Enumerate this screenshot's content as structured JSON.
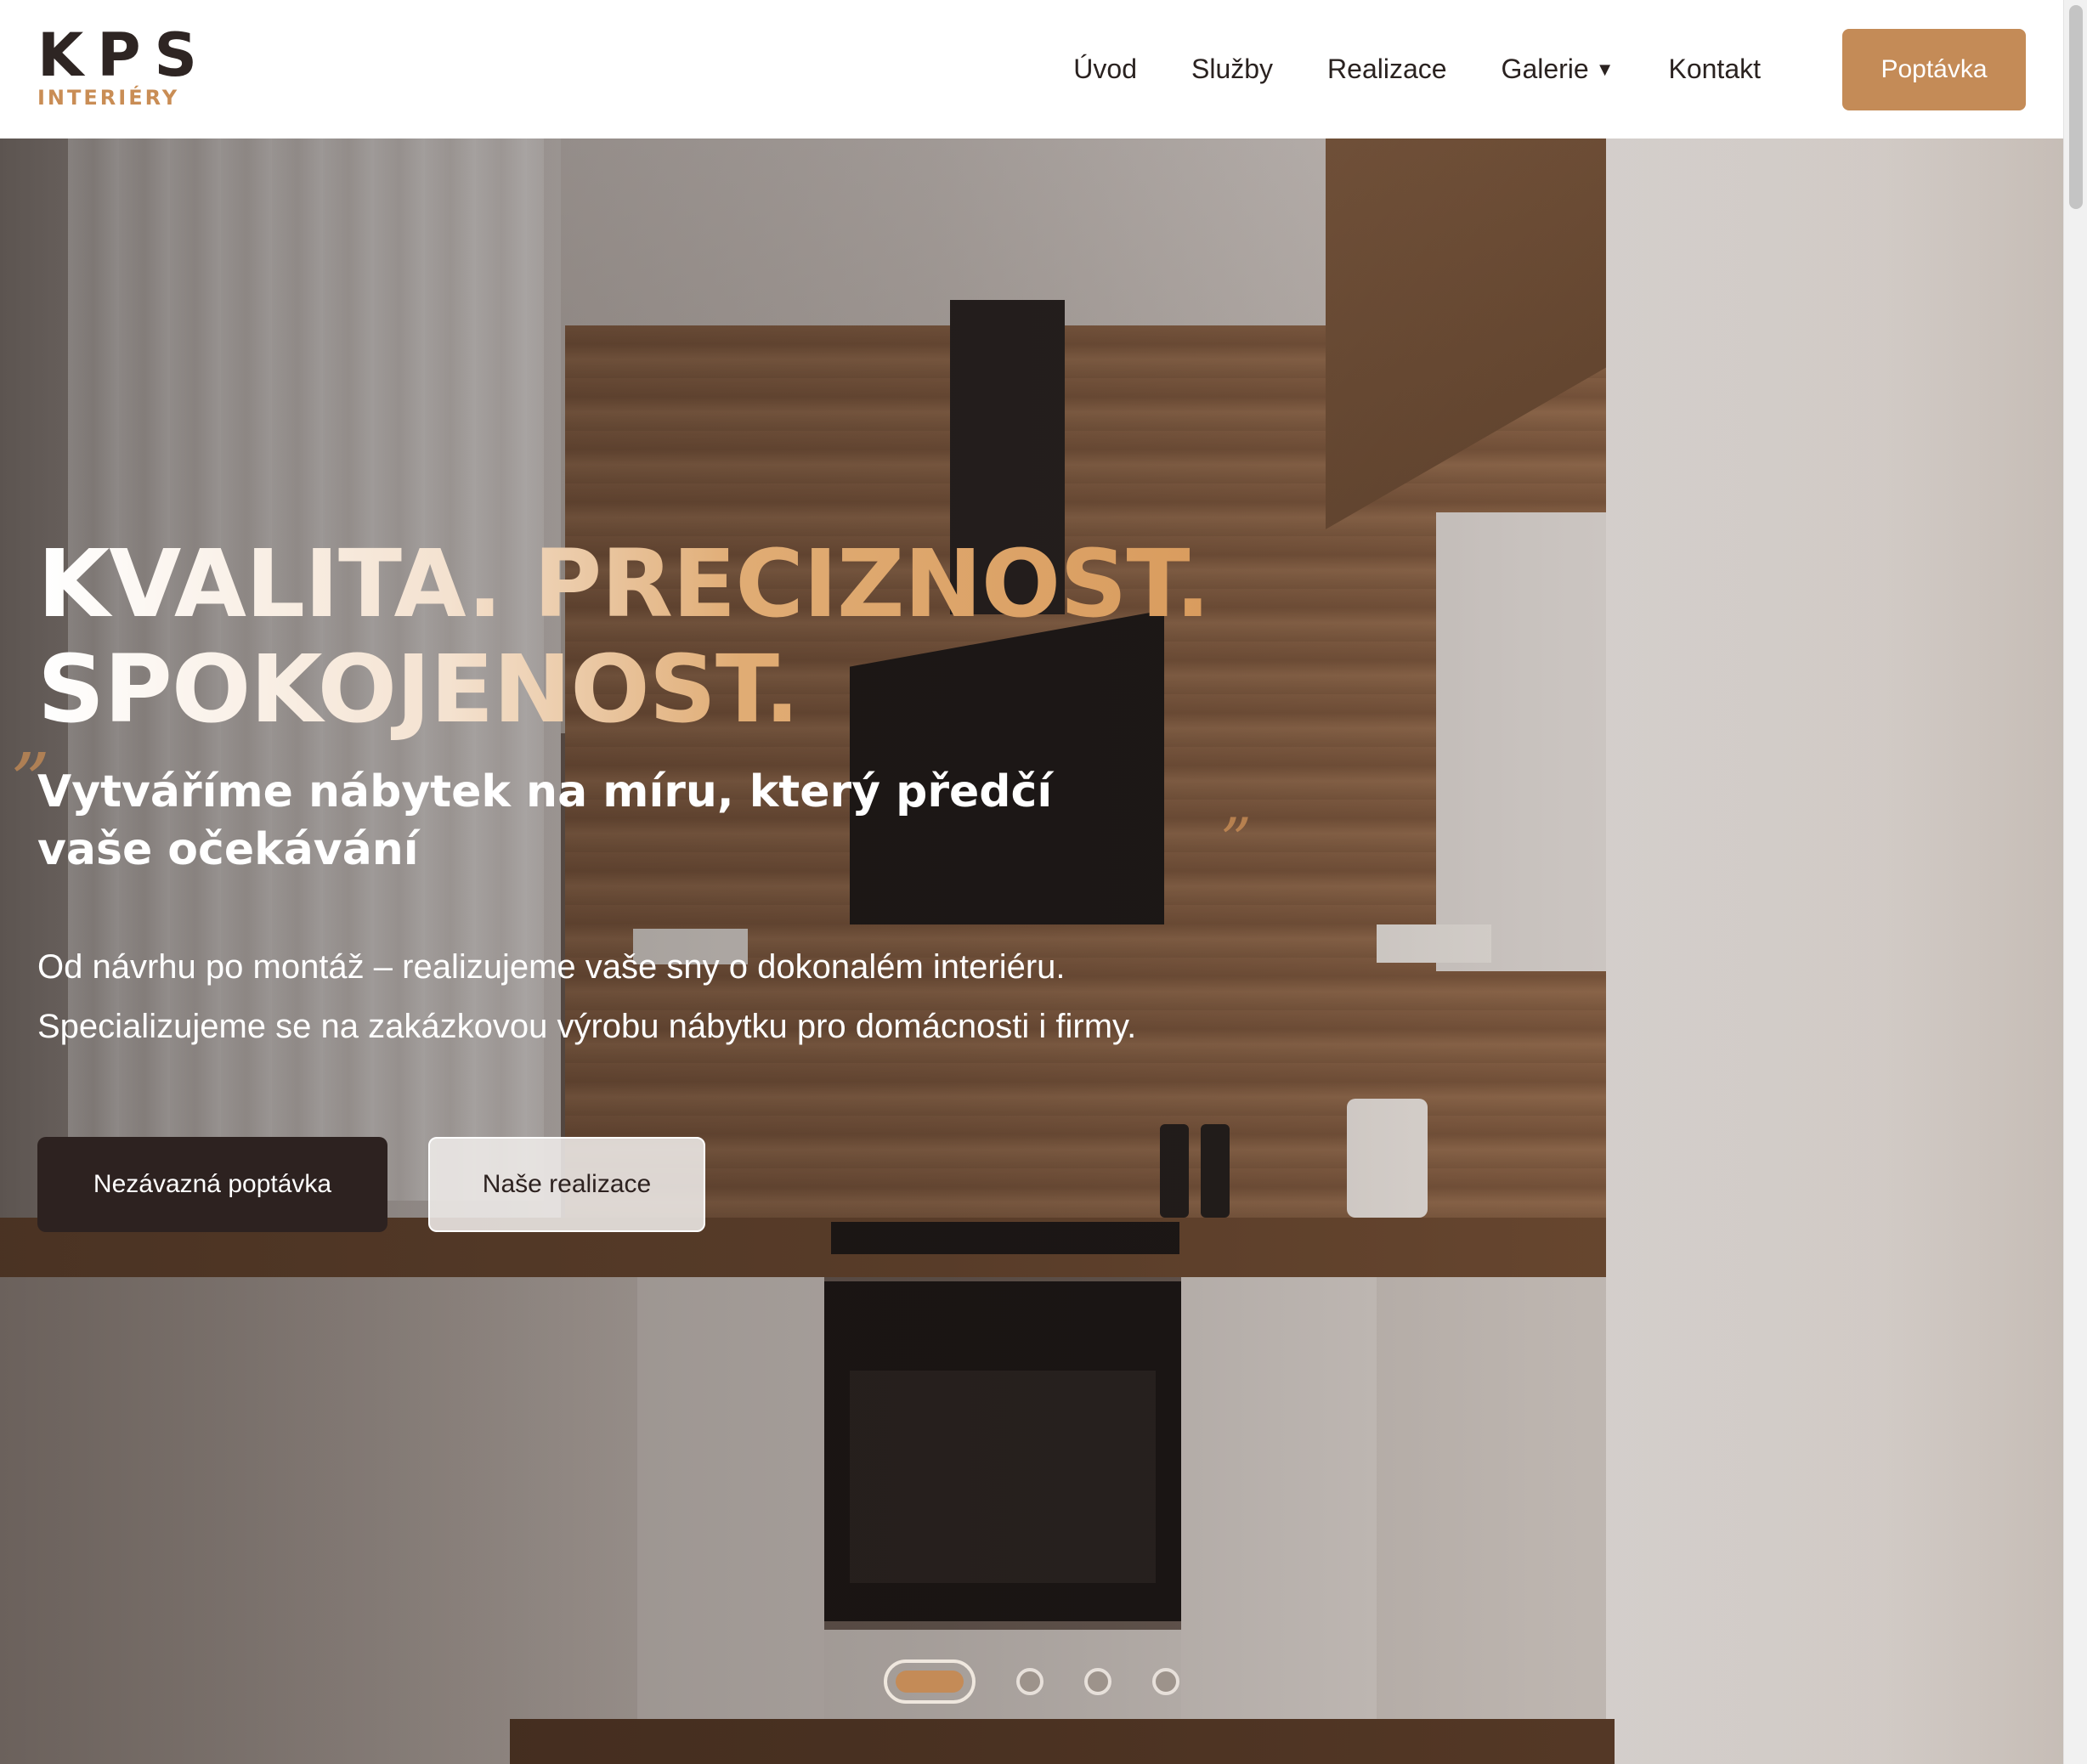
{
  "header": {
    "logo": {
      "primary": "KPS",
      "secondary": "INTERIÉRY"
    },
    "nav": [
      {
        "label": "Úvod"
      },
      {
        "label": "Služby"
      },
      {
        "label": "Realizace"
      },
      {
        "label": "Galerie",
        "dropdown_icon": "caret-down-icon"
      },
      {
        "label": "Kontakt"
      }
    ],
    "cta_label": "Poptávka"
  },
  "hero": {
    "title_line1": "KVALITA. PRECIZNOST.",
    "title_line2": "SPOKOJENOST.",
    "quote_open": "”",
    "quote_close": "”",
    "subtitle": "Vytváříme nábytek na míru, který předčí vaše očekávání",
    "description_line1": "Od návrhu po montáž – realizujeme vaše sny o dokonalém interiéru.",
    "description_line2": "Specializujeme se na zakázkovou výrobu nábytku pro domácnosti i firmy.",
    "primary_button": "Nezávazná poptávka",
    "secondary_button": "Naše realizace",
    "slider": {
      "total_slides": 4,
      "active_slide": 1
    }
  },
  "colors": {
    "accent": "#c48b57",
    "dark": "#2d2220",
    "text": "#2a2220"
  }
}
